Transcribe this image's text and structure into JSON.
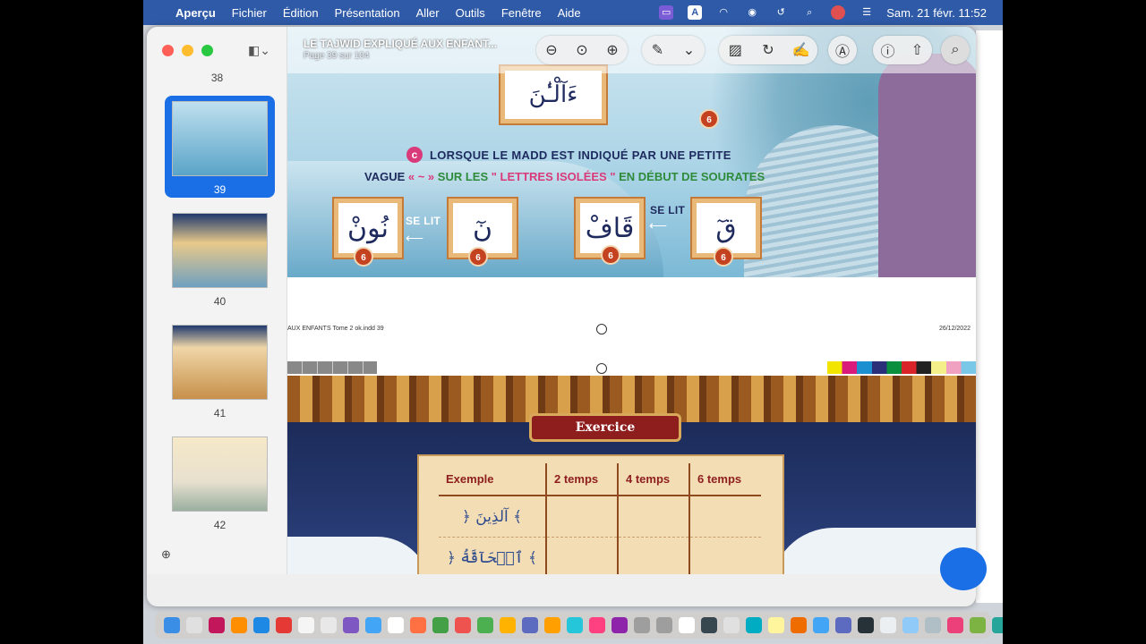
{
  "menubar": {
    "app": "Aperçu",
    "menus": [
      "Fichier",
      "Édition",
      "Présentation",
      "Aller",
      "Outils",
      "Fenêtre",
      "Aide"
    ],
    "datetime": "Sam. 21 févr.  11:52",
    "input_badge": "A"
  },
  "window": {
    "title": "LE TAJWID EXPLIQUÉ AUX ENFANT...",
    "subtitle": "Page 39 sur 104"
  },
  "sidebar": {
    "thumbnails": [
      {
        "label": "38"
      },
      {
        "label": "39",
        "selected": true
      },
      {
        "label": "40"
      },
      {
        "label": "41"
      },
      {
        "label": "42"
      }
    ]
  },
  "page39": {
    "top_arabic": "ءَآلْـٰٔنَ",
    "badge_value": "6",
    "rule_letter": "c",
    "rule_line1": "LORSQUE LE MADD EST INDIQUÉ PAR UNE PETITE",
    "rule_line2_a": "VAGUE",
    "rule_line2_b": "« ~ »",
    "rule_line2_c": "SUR LES",
    "rule_line2_d": "\" LETTRES ISOLÉES \"",
    "rule_line2_e": "EN DÉBUT DE SOURATES",
    "se_lit": "SE LIT",
    "cards": [
      "نُونْ",
      "نٓ",
      "قَافْ",
      "قٓ"
    ],
    "footer_left": "AUX ENFANTS Tome 2 ok.indd   39",
    "footer_right": "26/12/2022"
  },
  "page40": {
    "exercice_title": "Exercice",
    "table_headers": [
      "Exemple",
      "2 temps",
      "4 temps",
      "6 temps"
    ],
    "rows": [
      "﴿ آلذِينَ ﴾",
      "﴿ ٱلۡحَآقَّةُ ﴾"
    ]
  },
  "colors": {
    "menubar": "#2f5aa8",
    "accent": "#1a6ee6",
    "title_red": "#8e1e1e"
  },
  "toolbar_icons": [
    "sidebar-icon",
    "zoom-out-icon",
    "zoom-fit-icon",
    "zoom-in-icon",
    "markup-pen-icon",
    "chevron-down-icon",
    "shapes-icon",
    "rotate-icon",
    "signature-icon",
    "annotate-icon",
    "info-icon",
    "share-icon",
    "search-icon"
  ],
  "dock_count": 42
}
